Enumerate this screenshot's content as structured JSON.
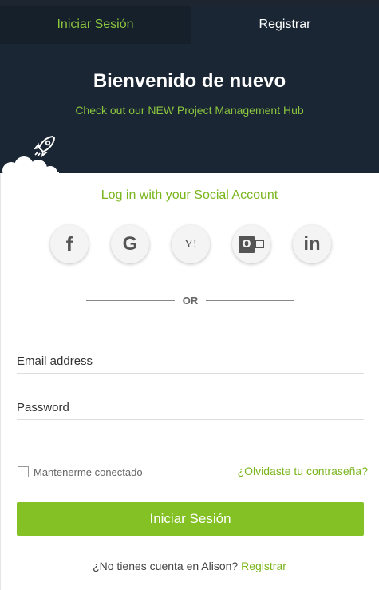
{
  "tabs": {
    "login": "Iniciar Sesión",
    "register": "Registrar"
  },
  "header": {
    "title": "Bienvenido de nuevo",
    "subtitle": "Check out our NEW Project Management Hub"
  },
  "social": {
    "title": "Log in with your Social Account",
    "providers": [
      {
        "name": "Facebook",
        "glyph": "f",
        "icon": "facebook-icon"
      },
      {
        "name": "Google",
        "glyph": "G",
        "icon": "google-icon"
      },
      {
        "name": "Yahoo",
        "glyph": "Y!",
        "icon": "yahoo-icon"
      },
      {
        "name": "Outlook",
        "glyph": "O",
        "icon": "outlook-icon"
      },
      {
        "name": "LinkedIn",
        "glyph": "in",
        "icon": "linkedin-icon"
      }
    ]
  },
  "divider": {
    "text": "OR"
  },
  "form": {
    "email_placeholder": "Email address",
    "password_placeholder": "Password",
    "remember_label": "Mantenerme conectado",
    "forgot_link": "¿Olvidaste tu contraseña?",
    "submit_label": "Iniciar Sesión"
  },
  "footer": {
    "prompt": "¿No tienes cuenta en Alison?",
    "register_link": "Registrar"
  },
  "colors": {
    "accent": "#84c124",
    "header_bg": "#1a2633",
    "link": "#7ab51d"
  }
}
